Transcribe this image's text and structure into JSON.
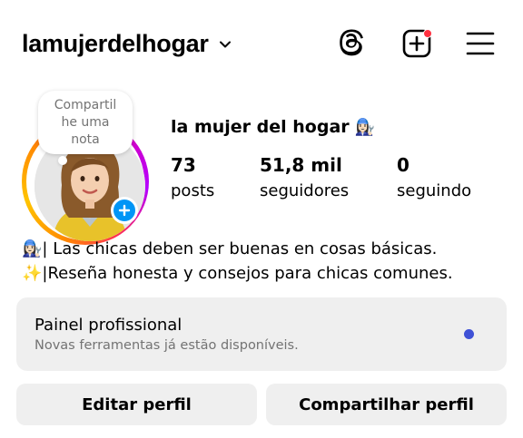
{
  "header": {
    "username": "lamujerdelhogar",
    "icons": {
      "dropdown": "chevron-down-icon",
      "threads": "threads-icon",
      "create": "create-plus-icon",
      "menu": "hamburger-menu-icon"
    },
    "notification_color": "#ff3040"
  },
  "profile": {
    "note_bubble": "Compartil he uma nota",
    "display_name": "la mujer del hogar",
    "display_emoji": "👩🏻‍🔧",
    "stats": [
      {
        "value": "73",
        "label": "posts"
      },
      {
        "value": "51,8 mil",
        "label": "seguidores"
      },
      {
        "value": "0",
        "label": "seguindo"
      }
    ],
    "bio_lines": [
      "👩🏻‍🔧| Las chicas deben ser buenas en cosas básicas.",
      "✨|Reseña honesta y consejos para chicas comunes."
    ],
    "add_badge_color": "#0095f6"
  },
  "dashboard": {
    "title": "Painel profissional",
    "subtitle": "Novas ferramentas já estão disponíveis.",
    "dot_color": "#3f51d6"
  },
  "actions": {
    "edit_label": "Editar perfil",
    "share_label": "Compartilhar perfil"
  }
}
